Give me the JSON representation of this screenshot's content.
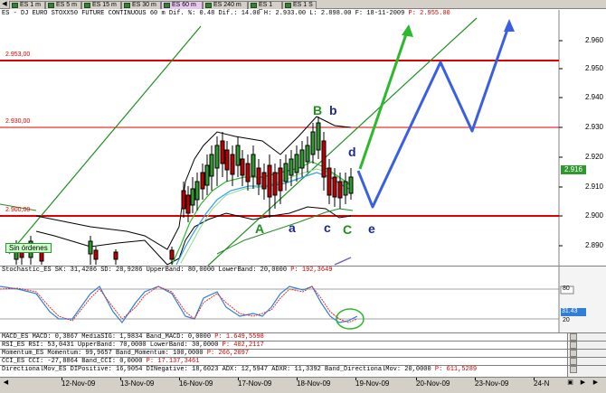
{
  "tabs": [
    {
      "label": "ES 1 m",
      "active": false
    },
    {
      "label": "ES 5 m",
      "active": false
    },
    {
      "label": "ES 15 m",
      "active": false
    },
    {
      "label": "ES 30 m",
      "active": false
    },
    {
      "label": "ES 60 m",
      "active": true
    },
    {
      "label": "ES 240 m",
      "active": false
    },
    {
      "label": "ES 1 D",
      "active": false
    },
    {
      "label": "ES 1 S",
      "active": false
    }
  ],
  "header": {
    "instrument": "ES - DJ EURO STOXX50 FUTURE CONTINUOUS",
    "timeframe": "60 m",
    "dif": "Dif. %: 0.48",
    "stats": "Dif.: 14.00  H: 2.933.00  L: 2.898.00  F: 18-11-2009",
    "price": "P: 2.955.00"
  },
  "levels": {
    "level_top": "2.953,00",
    "level_mid": "2.930,00",
    "level_low": "2.900,00"
  },
  "price_axis": [
    "2.960",
    "2.950",
    "2.940",
    "2.930",
    "2.920",
    "2.910",
    "2.900",
    "2.890"
  ],
  "current_price": "2.916",
  "annotations": {
    "B": "B",
    "b": "b",
    "d": "d",
    "A": "A",
    "a": "a",
    "c_small": "c",
    "C": "C",
    "e": "e",
    "sin_ordenes": "Sin órdenes"
  },
  "stochastic": {
    "header": "Stochastic_ES SK: 31,4286 SD: 28,9286 UpperBand: 80,0000 LowerBand: 20,0000",
    "price": "P: 192,3649",
    "axis_top": "80",
    "axis_value": "31.43",
    "axis_bottom": "20"
  },
  "indicators": [
    {
      "name": "macd",
      "text": "MACD_ES MACD: 0,3867 MediaSIG: 1,9834 Band_MACD: 0,0000",
      "price": "P: 1.649,5598"
    },
    {
      "name": "rsi",
      "text": "RSI_ES RSI: 53,0431 UpperBand: 70,0000 LowerBand: 30,0000",
      "price": "P: 402,2117"
    },
    {
      "name": "momentum",
      "text": "Momentum_ES Momentum: 99,9657 Band_Momentum: 100,0000",
      "price": "P: 266,2097"
    },
    {
      "name": "cci",
      "text": "CCI_ES CCI: -27,8864 Band_CCI: 0,0000",
      "price": "P: 17.137,3461"
    },
    {
      "name": "directional",
      "text": "DirectionalMov_ES DIPositive: 16,9054 DINegative: 18,6023 ADX: 12,5947 ADXR: 11,3392 Band_DirectionalMov: 20,0000",
      "price": "P: 611,5289"
    }
  ],
  "dates": [
    "12-Nov-09",
    "13-Nov-09",
    "16-Nov-09",
    "17-Nov-09",
    "18-Nov-09",
    "19-Nov-09",
    "20-Nov-09",
    "23-Nov-09",
    "24-N"
  ],
  "colors": {
    "support_red": "#e00000",
    "trend_green": "#1f8f1f",
    "projection_blue": "#3a5fe0",
    "arrow_green": "#2eb82e",
    "tab_active": "#e8c8f0"
  }
}
